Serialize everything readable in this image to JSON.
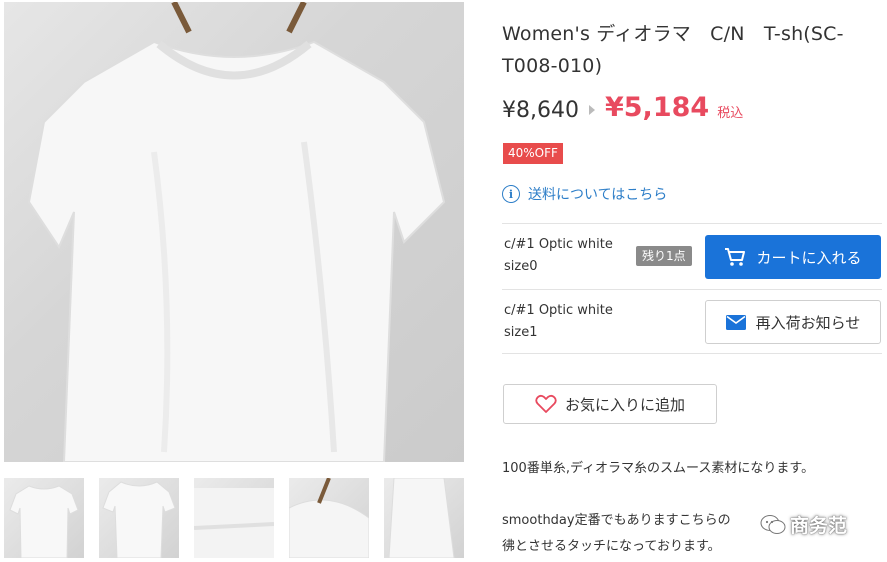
{
  "product": {
    "title": "Women's ディオラマ　C/N　T-sh(SC-T008-010)",
    "price_original": "¥8,640",
    "price_sale": "¥5,184",
    "tax_label": "税込",
    "discount_badge": "40%OFF",
    "shipping_link": "送料についてはこちら"
  },
  "variants": [
    {
      "color": "c/#1 Optic white",
      "size": "size0",
      "stock_badge": "残り1点",
      "action_label": "カートに入れる"
    },
    {
      "color": "c/#1 Optic white",
      "size": "size1",
      "action_label": "再入荷お知らせ"
    }
  ],
  "favorite_label": "お気に入りに追加",
  "description": {
    "line1": "100番単糸,ディオラマ糸のスムース素材になります。",
    "line2": "smoothday定番でもありますこちらの",
    "line3": "彿とさせるタッチになっております。"
  },
  "watermark": "商务范",
  "colors": {
    "sale": "#e84a5f",
    "badge": "#e84c4c",
    "link": "#2d7ec8",
    "primary_button": "#1a73d9"
  },
  "icons": {
    "info": "info-circle-icon",
    "cart": "cart-icon",
    "mail": "mail-icon",
    "heart": "heart-outline-icon"
  }
}
